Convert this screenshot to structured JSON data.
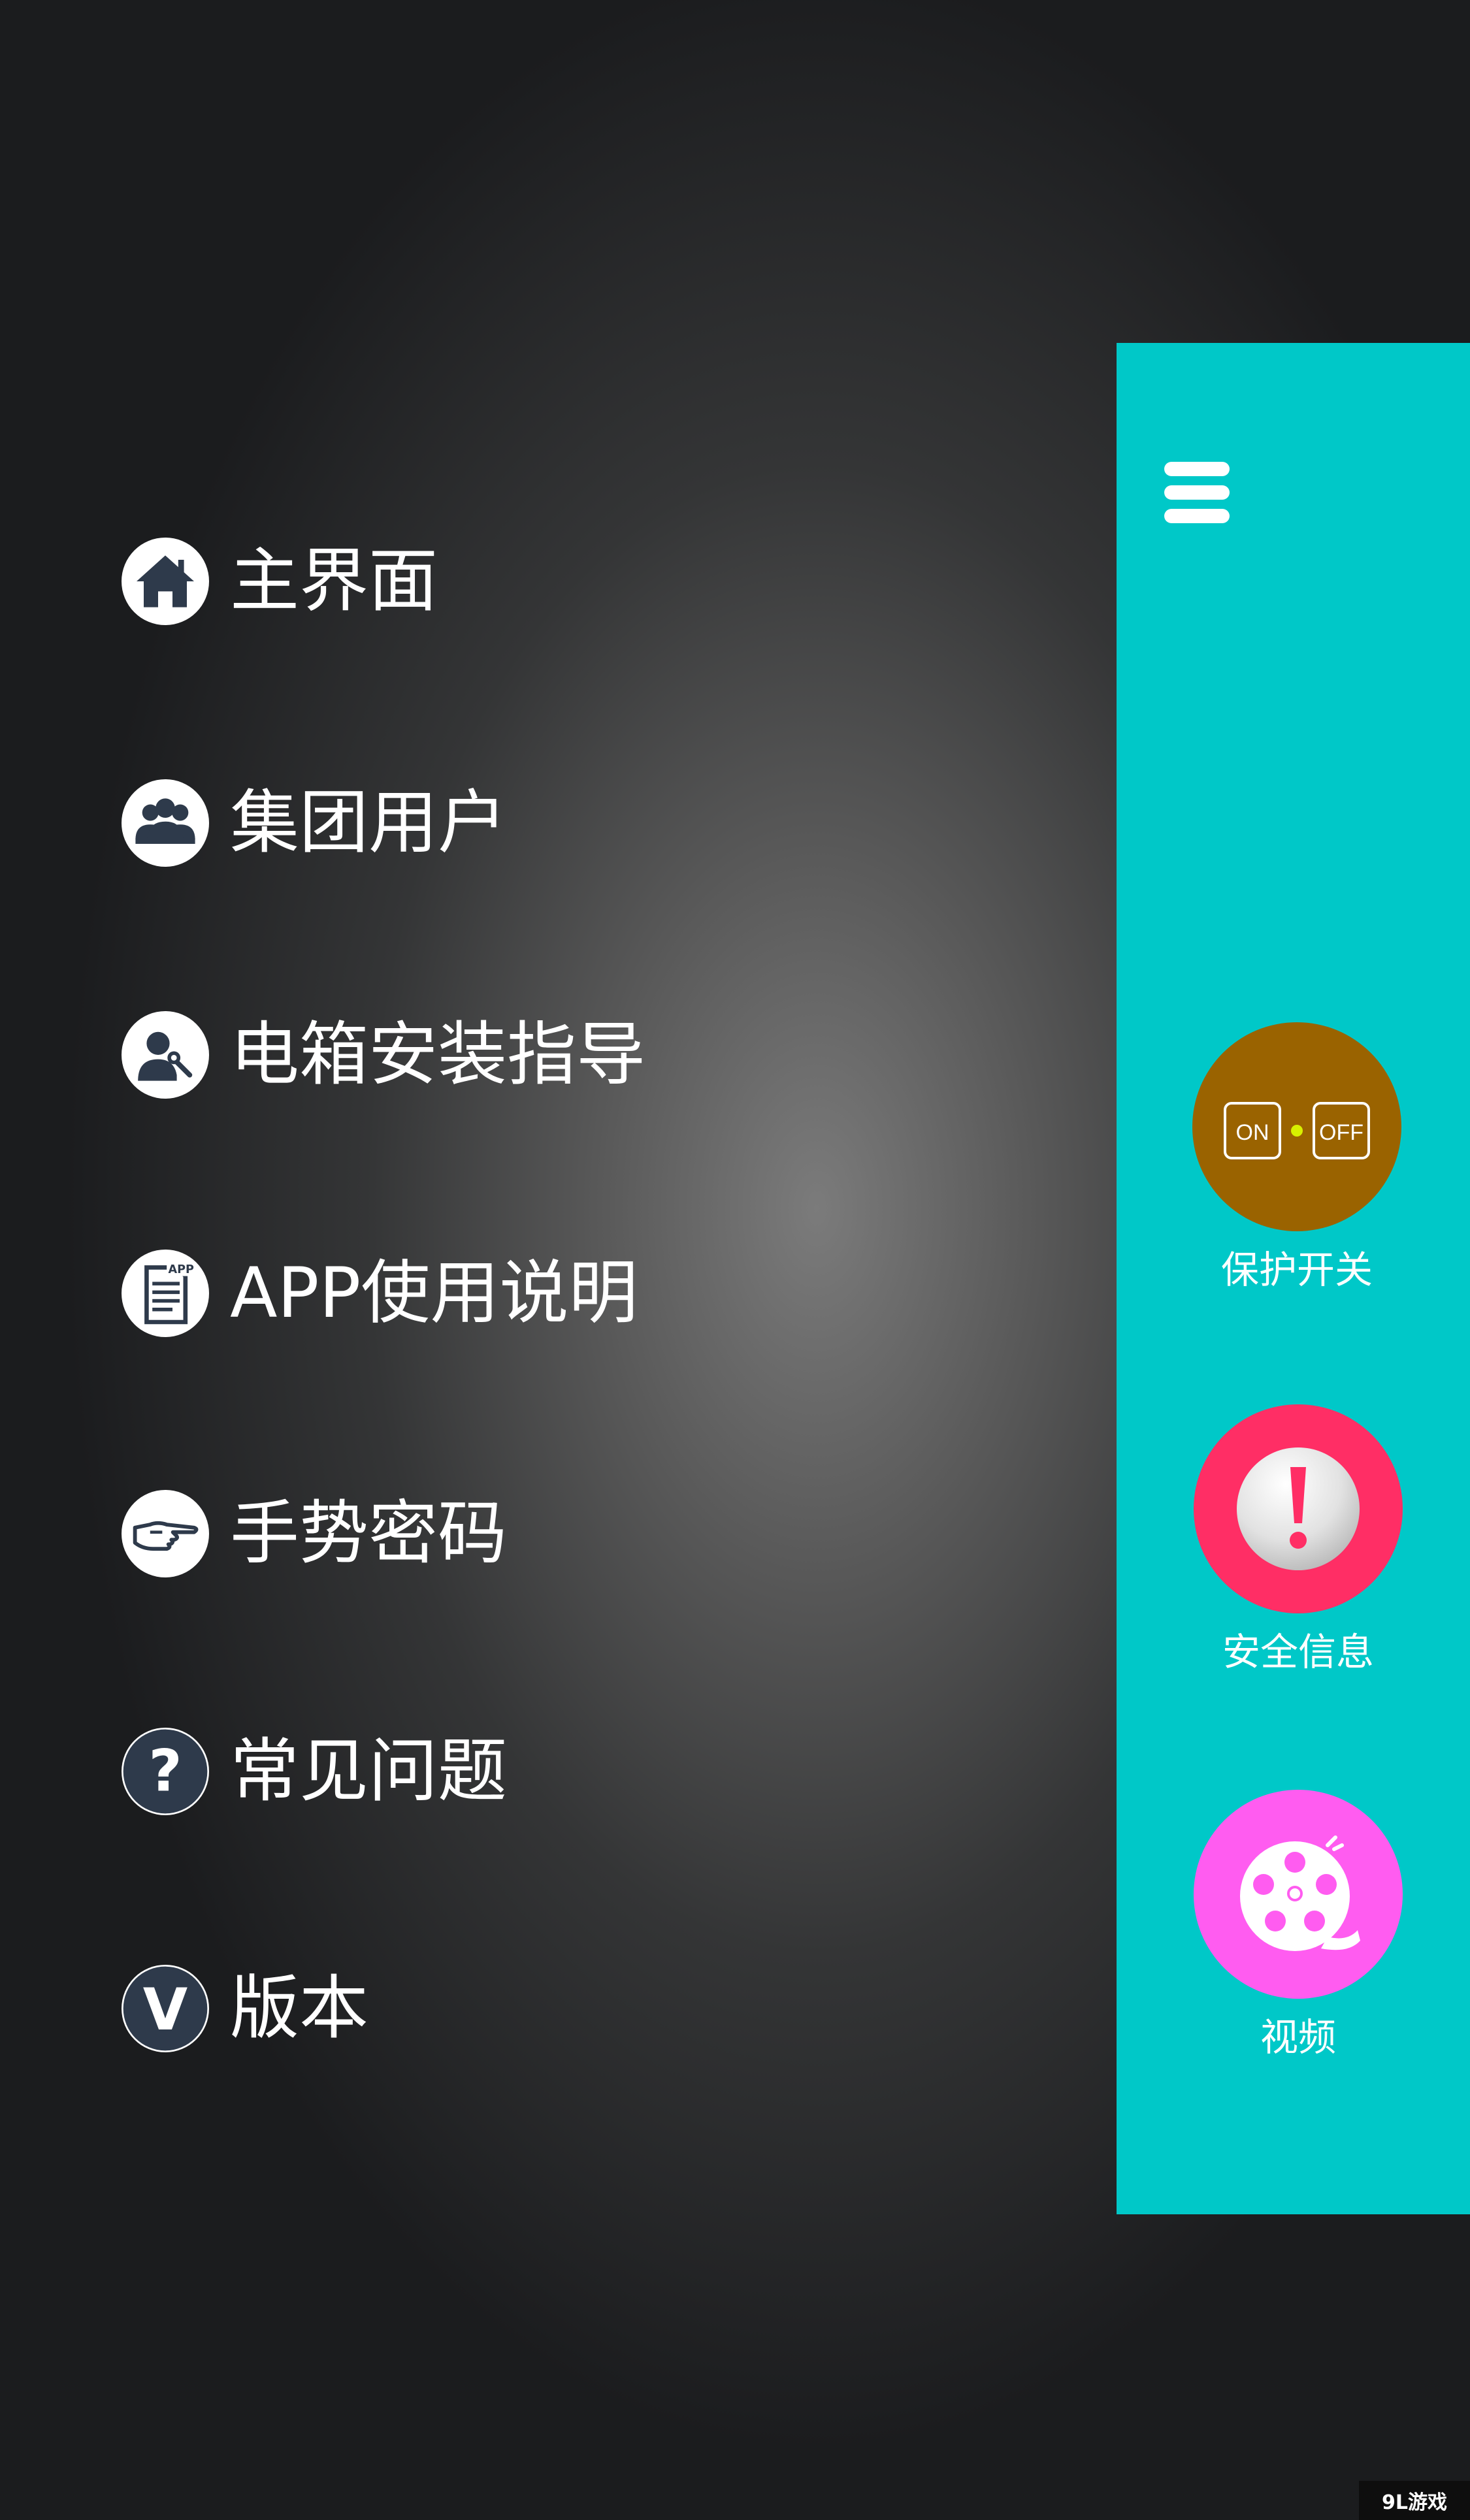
{
  "menu": {
    "items": [
      {
        "label": "主界面",
        "icon": "house-icon"
      },
      {
        "label": "集团用户",
        "icon": "group-users-icon"
      },
      {
        "label": "电箱安装指导",
        "icon": "installer-wrench-icon"
      },
      {
        "label": "APP使用说明",
        "icon": "app-document-icon"
      },
      {
        "label": "手势密码",
        "icon": "pointing-hand-icon"
      },
      {
        "label": "常见问题",
        "icon": "question-mark-icon"
      },
      {
        "label": "版本",
        "icon": "version-v-icon"
      }
    ]
  },
  "panel": {
    "menu_icon": "hamburger-menu-icon",
    "quick_actions": [
      {
        "label": "保护开关",
        "icon": "on-off-switch-icon",
        "on_text": "ON",
        "off_text": "OFF",
        "color": "#9a6300"
      },
      {
        "label": "安全信息",
        "icon": "exclamation-icon",
        "color": "#ff2e65"
      },
      {
        "label": "视频",
        "icon": "film-reel-icon",
        "color": "#ff5cf0"
      }
    ]
  },
  "colors": {
    "panel": "#00c8c8",
    "menu_icon_fg": "#2e3a4b",
    "text": "#ffffff"
  },
  "watermark": "9L游戏"
}
